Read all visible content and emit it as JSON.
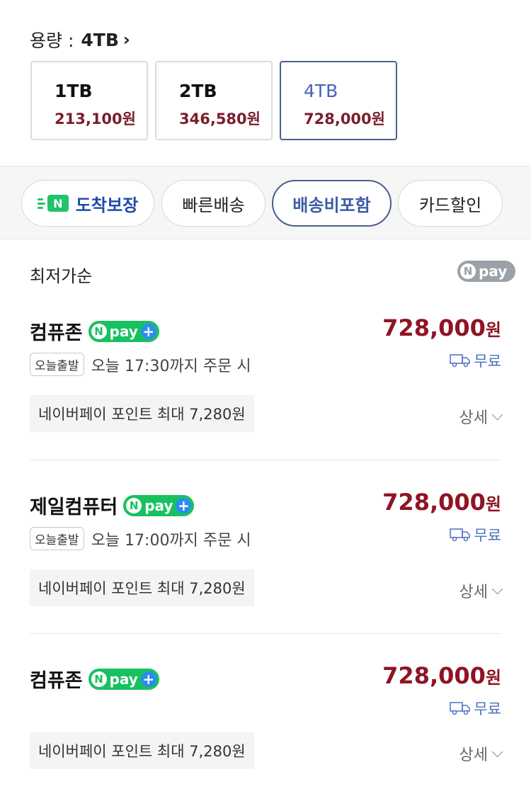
{
  "capacity": {
    "label": "용량 :",
    "selected": "4TB",
    "options": [
      {
        "name": "1TB",
        "price": "213,100원"
      },
      {
        "name": "2TB",
        "price": "346,580원"
      },
      {
        "name": "4TB",
        "price": "728,000원"
      }
    ]
  },
  "filters": [
    {
      "label": "도착보장",
      "icon_text": "N"
    },
    {
      "label": "빠른배송"
    },
    {
      "label": "배송비포함"
    },
    {
      "label": "카드할인"
    }
  ],
  "list": {
    "sort_label": "최저가순",
    "npay_label": "pay",
    "npay_letter": "N"
  },
  "offers": [
    {
      "seller": "컴퓨존",
      "npay": "pay",
      "price": "728,000",
      "unit": "원",
      "shipping": "무료",
      "tag": "오늘출발",
      "dispatch": "오늘 17:30까지 주문 시",
      "point": "네이버페이 포인트 최대 7,280원",
      "detail": "상세"
    },
    {
      "seller": "제일컴퓨터",
      "npay": "pay",
      "price": "728,000",
      "unit": "원",
      "shipping": "무료",
      "tag": "오늘출발",
      "dispatch": "오늘 17:00까지 주문 시",
      "point": "네이버페이 포인트 최대 7,280원",
      "detail": "상세"
    },
    {
      "seller": "컴퓨존",
      "npay": "pay",
      "price": "728,000",
      "unit": "원",
      "shipping": "무료",
      "point": "네이버페이 포인트 최대 7,280원",
      "detail": "상세"
    }
  ],
  "colors": {
    "price": "#8f1424",
    "selected_border": "#4a5f8f",
    "npay_green": "#18c160",
    "shipping_blue": "#4d6fc2"
  }
}
